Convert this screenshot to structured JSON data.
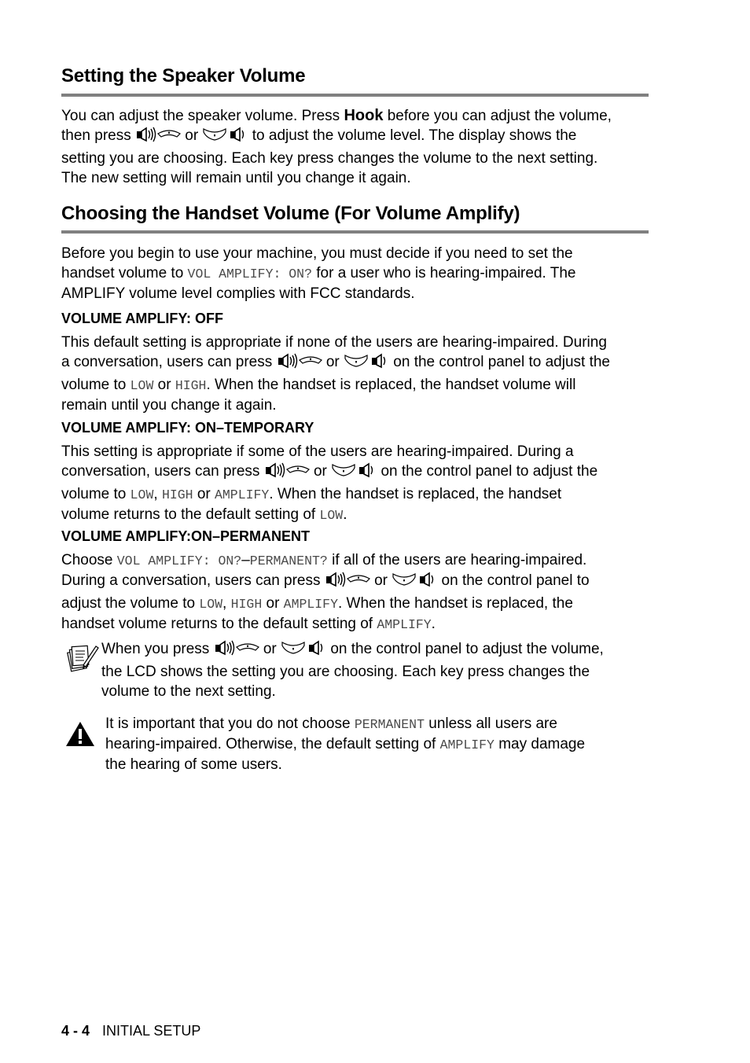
{
  "section1": {
    "title": "Setting the Speaker Volume",
    "p1_a": "You can adjust the speaker volume. Press ",
    "hook": "Hook",
    "p1_b": " before you can adjust the volume,",
    "p1_c": "then press ",
    "or": " or ",
    "p1_d": " to adjust the volume level. The display shows the",
    "p1_e": "setting you are choosing. Each key press changes the volume to the next setting.",
    "p1_f": "The new setting will remain until you change it again."
  },
  "section2": {
    "title": "Choosing the Handset Volume (For Volume Amplify)",
    "intro_a": "Before you begin to use your machine, you must decide if you need to set the",
    "intro_b": "handset volume to ",
    "intro_mono": "VOL AMPLIFY: ON?",
    "intro_c": " for a user who is hearing-impaired. The",
    "intro_d": "AMPLIFY volume level complies with FCC standards.",
    "off": {
      "heading": "VOLUME AMPLIFY: OFF",
      "l1": "This default setting is appropriate if none of the users are hearing-impaired. During",
      "l2_a": "a conversation, users can press ",
      "l2_b": " on the control panel to adjust the",
      "l3_a": "volume to ",
      "low": "LOW",
      "l3_or": " or ",
      "high": "HIGH",
      "l3_b": ". When the handset is replaced, the handset volume will",
      "l4": "remain until you change it again."
    },
    "temporary": {
      "heading": "VOLUME AMPLIFY: ON–TEMPORARY",
      "l1": "This setting is appropriate if some of the users are hearing-impaired. During a",
      "l2_a": "conversation, users can press ",
      "l2_b": " on the control panel to adjust the",
      "l3_a": "volume to ",
      "low": "LOW",
      "comma": ", ",
      "high": "HIGH",
      "l3_or": " or ",
      "amplify": "AMPLIFY",
      "l3_b": ". When the handset is replaced, the handset",
      "l4_a": "volume returns to the default setting of ",
      "l4_low": "LOW",
      "l4_b": "."
    },
    "permanent": {
      "heading": "VOLUME AMPLIFY:ON–PERMANENT",
      "l1_a": "Choose ",
      "l1_mono": "VOL AMPLIFY: ON?",
      "l1_dash": "–",
      "l1_mono2": "PERMANENT?",
      "l1_b": " if all of the users are hearing-impaired.",
      "l2_a": "During a conversation, users can press ",
      "l2_b": " on the control panel to",
      "l3_a": "adjust the volume to ",
      "low": "LOW",
      "comma": ", ",
      "high": "HIGH",
      "l3_or": " or ",
      "amplify": "AMPLIFY",
      "l3_b": ". When the handset is replaced, the",
      "l4_a": "handset volume returns to the default setting of ",
      "l4_amp": "AMPLIFY",
      "l4_b": "."
    },
    "note": {
      "icon": "note-pad-icon",
      "l1_a": "When you press ",
      "l1_b": " on the control panel to adjust the volume,",
      "l2": "the LCD shows the setting you are choosing. Each key press changes the",
      "l3": "volume to the next setting."
    },
    "warning": {
      "icon": "warning-icon",
      "l1_a": "It is important that you do not choose ",
      "l1_mono": "PERMANENT",
      "l1_b": " unless all users are",
      "l2_a": "hearing-impaired. Otherwise, the default setting of ",
      "l2_mono": "AMPLIFY",
      "l2_b": " may damage",
      "l3": "the hearing of some users."
    }
  },
  "footer": {
    "page": "4 - 4",
    "chapter": "INITIAL SETUP"
  }
}
